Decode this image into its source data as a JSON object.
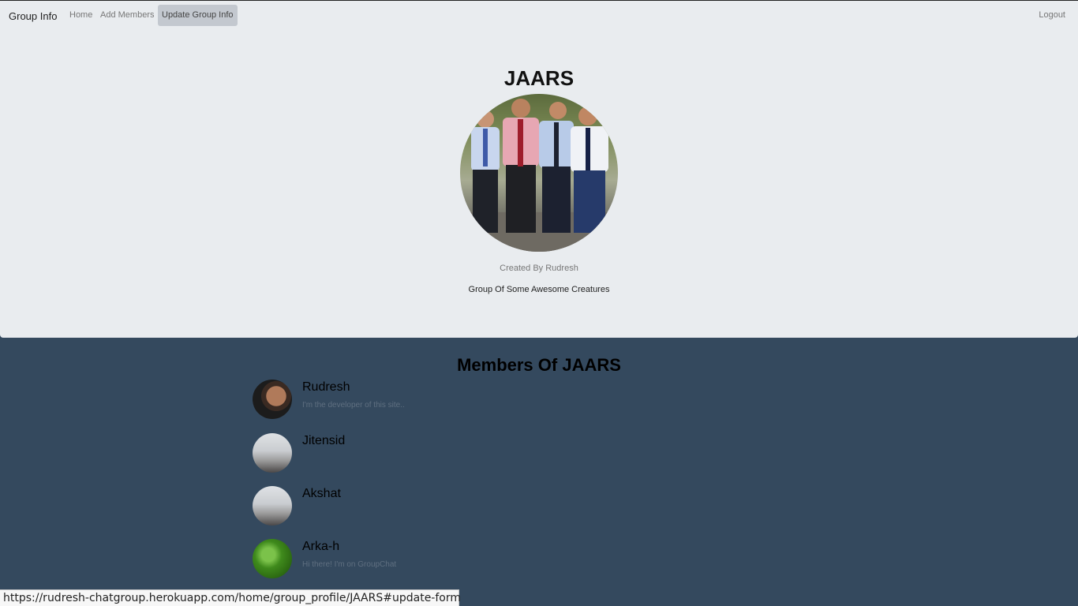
{
  "navbar": {
    "brand": "Group Info",
    "links": [
      "Home",
      "Add Members",
      "Update Group Info"
    ],
    "logout": "Logout"
  },
  "group": {
    "name": "JAARS",
    "photo_icon": "group-photo",
    "created_by": "Created By Rudresh",
    "description": "Group Of Some Awesome Creatures"
  },
  "members": {
    "title": "Members Of JAARS",
    "list": [
      {
        "name": "Rudresh",
        "status": "I'm the developer of this site..",
        "avatar": "person-photo"
      },
      {
        "name": "Jitensid",
        "status": "",
        "avatar": "mountain-photo"
      },
      {
        "name": "Akshat",
        "status": "",
        "avatar": "mountain-photo"
      },
      {
        "name": "Arka-h",
        "status": "Hi there! I'm on GroupChat",
        "avatar": "leaf-photo"
      }
    ]
  },
  "status_bar": {
    "url": "https://rudresh-chatgroup.herokuapp.com/home/group_profile/JAARS#update-form"
  },
  "colors": {
    "header_bg": "#e9ecef",
    "page_bg": "#34495e",
    "active_nav_bg": "#c3c8cf"
  }
}
